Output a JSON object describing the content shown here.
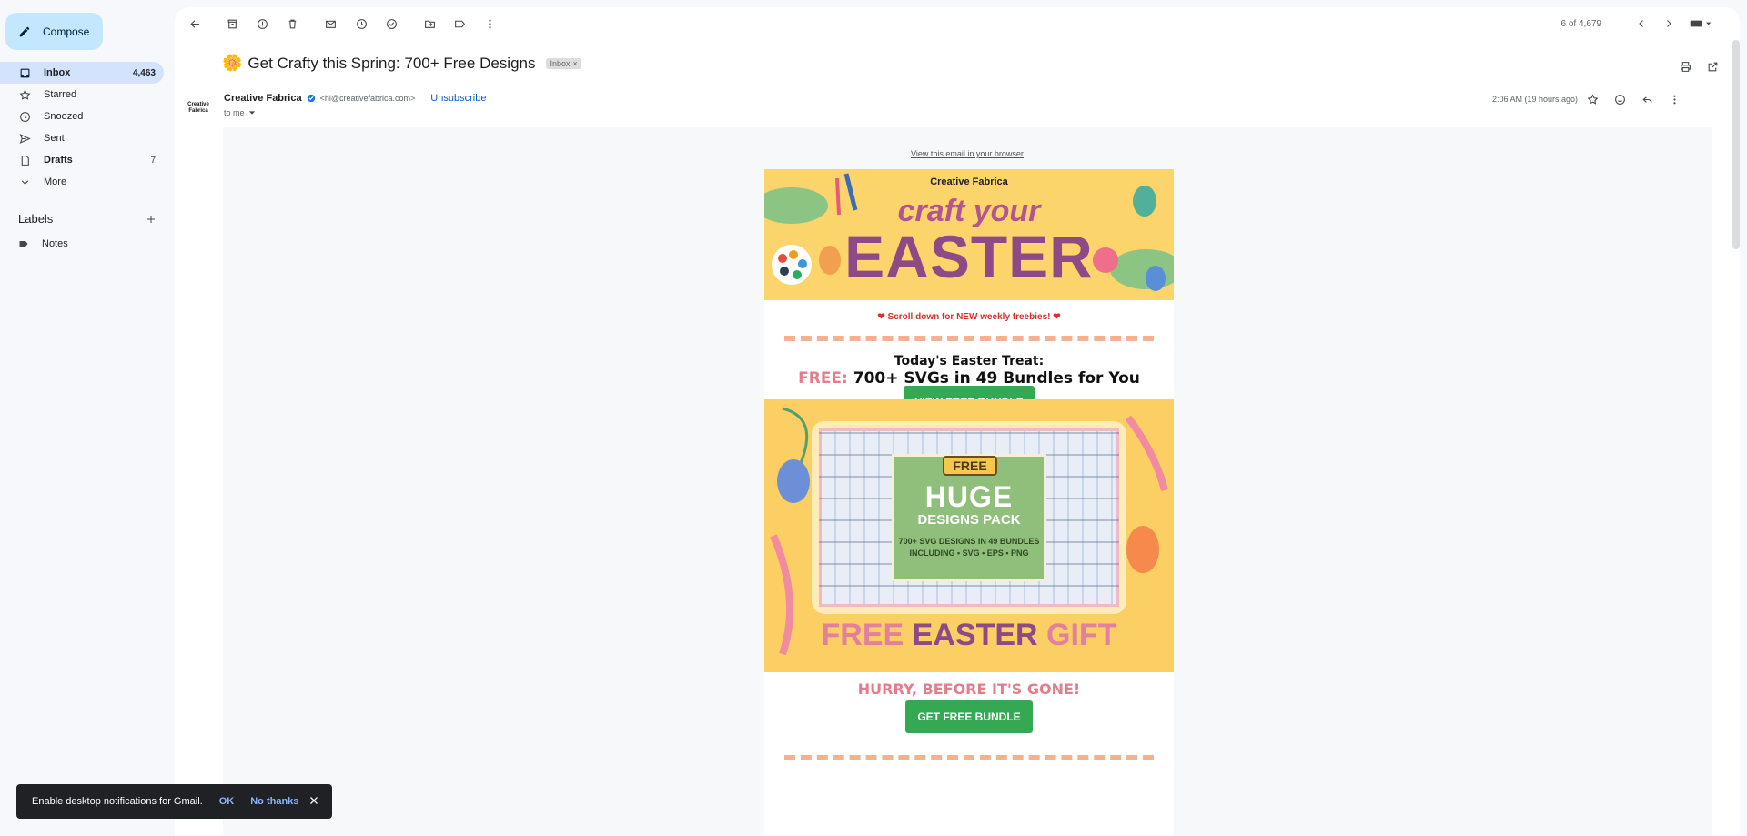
{
  "sidebar": {
    "compose_label": "Compose",
    "items": [
      {
        "label": "Inbox",
        "count": "4,463",
        "icon": "inbox-icon"
      },
      {
        "label": "Starred",
        "count": "",
        "icon": "star-icon"
      },
      {
        "label": "Snoozed",
        "count": "",
        "icon": "clock-icon"
      },
      {
        "label": "Sent",
        "count": "",
        "icon": "send-icon"
      },
      {
        "label": "Drafts",
        "count": "7",
        "icon": "draft-icon"
      },
      {
        "label": "More",
        "count": "",
        "icon": "chevron-down-icon"
      }
    ],
    "labels_heading": "Labels",
    "labels": [
      {
        "label": "Notes",
        "icon": "label-icon"
      }
    ]
  },
  "toolbar": {
    "pager": "6 of 4,679"
  },
  "email": {
    "subject_emoji": "🌼",
    "subject": "Get Crafty this Spring: 700+ Free Designs",
    "inbox_badge": "Inbox",
    "sender_avatar": "Creative Fabrica",
    "sender_name": "Creative Fabrica",
    "sender_email": "<hi@creativefabrica.com>",
    "unsubscribe": "Unsubscribe",
    "to": "to me",
    "time": "2:06 AM (19 hours ago)"
  },
  "content": {
    "view_browser": "View this email in your browser",
    "banner_brand": "Creative Fabrica",
    "banner_line1": "craft your",
    "banner_line2": "EASTER",
    "scroll_note": "Scroll down for NEW weekly freebies!",
    "treat_title": "Today's Easter Treat:",
    "treat_free": "FREE:",
    "treat_rest": "700+ SVGs in 49 Bundles for You",
    "view_button": "VIEW FREE BUNDLE",
    "promo_free": "FREE",
    "promo_huge": "HUGE",
    "promo_pack": "DESIGNS PACK",
    "promo_small_1": "700+ SVG DESIGNS IN 49 BUNDLES",
    "promo_small_2": "INCLUDING • SVG • EPS • PNG",
    "promo_gift_1": "FREE",
    "promo_gift_2": "EASTER",
    "promo_gift_3": "GIFT",
    "hurry": "HURRY, BEFORE IT'S GONE!",
    "get_button": "GET FREE BUNDLE"
  },
  "snackbar": {
    "message": "Enable desktop notifications for Gmail.",
    "ok": "OK",
    "no_thanks": "No thanks"
  },
  "colors": {
    "compose_bg": "#c2e7ff",
    "active_nav": "#d3e3fd",
    "link": "#0b57d0",
    "button_green": "#34a853",
    "banner_yellow": "#fbd46c",
    "accent_pink": "#e57c8c"
  }
}
